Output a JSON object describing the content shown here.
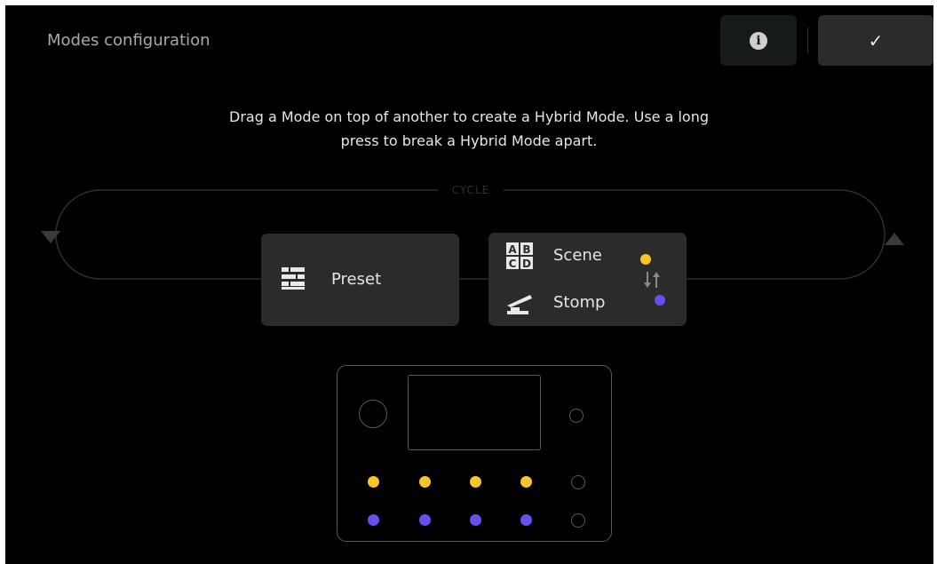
{
  "header": {
    "title": "Modes configuration"
  },
  "toolbar": {
    "info_icon": "info-icon",
    "confirm_icon": "checkmark-icon",
    "confirm_glyph": "✓"
  },
  "instructions": "Drag a Mode on top of another to create a Hybrid Mode. Use a long press to break a Hybrid Mode apart.",
  "cycle": {
    "label": "CYCLE"
  },
  "modes": {
    "preset": {
      "label": "Preset",
      "icon": "preset-grid-icon"
    },
    "hybrid": {
      "primary": {
        "label": "Scene",
        "icon": "abcd-scene-icon",
        "color": "#f6c52a",
        "letters": [
          "A",
          "B",
          "C",
          "D"
        ]
      },
      "secondary": {
        "label": "Stomp",
        "icon": "stomp-pedal-icon",
        "color": "#6a4ef0"
      },
      "swap_icon": "swap-arrows-icon"
    }
  },
  "device": {
    "top_row_color": "#f6c52a",
    "bottom_row_color": "#6a4ef0"
  }
}
